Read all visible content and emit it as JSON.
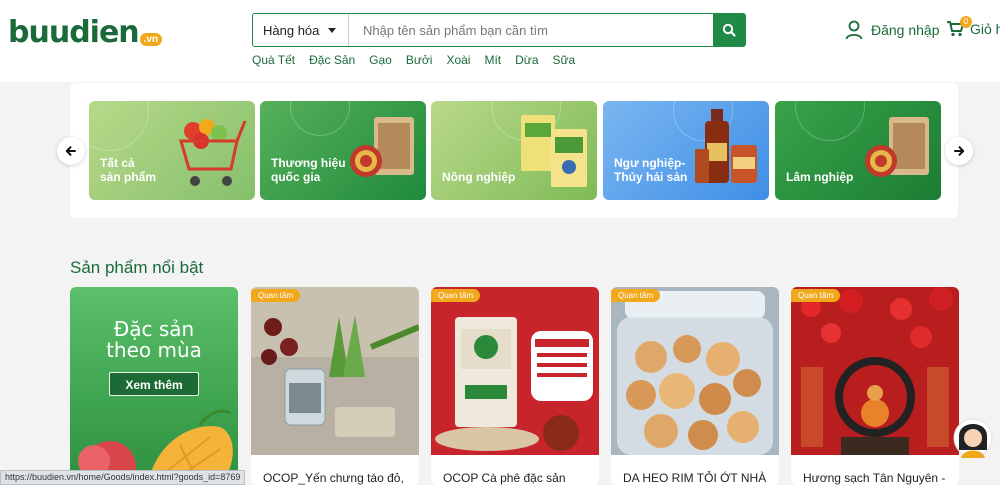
{
  "header": {
    "logo": {
      "text": "buudien",
      "badge": ".vn"
    },
    "search": {
      "category": "Hàng hóa",
      "placeholder": "Nhập tên sản phẩm bạn cần tìm"
    },
    "quick_links": [
      "Quà Tết",
      "Đặc Sản",
      "Gạo",
      "Bưởi",
      "Xoài",
      "Mít",
      "Dừa",
      "Sữa"
    ],
    "login_label": "Đăng nhập",
    "cart_label": "Giỏ h",
    "cart_count": "0"
  },
  "categories": [
    {
      "label": "Tất cả\nsản phẩm"
    },
    {
      "label": "Thương hiệu\nquốc gia"
    },
    {
      "label": "Nông nghiệp"
    },
    {
      "label": "Ngư nghiệp-\nThủy hải sản"
    },
    {
      "label": "Lâm nghiệp"
    }
  ],
  "featured": {
    "title": "Sản phẩm nổi bật",
    "promo": {
      "title": "Đặc sản\ntheo mùa",
      "button": "Xem thêm"
    },
    "products": [
      {
        "badge": "Quan tâm",
        "name": "OCOP_Yến chưng táo đỏ,"
      },
      {
        "badge": "Quan tâm",
        "name": "OCOP Cà phê đặc sản"
      },
      {
        "badge": "Quan tâm",
        "name": "DA HEO RIM TỎI ỚT NHÀ"
      },
      {
        "badge": "Quan tâm",
        "name": "Hương sạch Tân Nguyên -"
      }
    ]
  },
  "status_url": "https://buudien.vn/home/Goods/index.html?goods_id=8769",
  "colors": {
    "brand_green": "#1b6b3a",
    "accent_orange": "#f2a81d",
    "search_green": "#1f8a45"
  }
}
